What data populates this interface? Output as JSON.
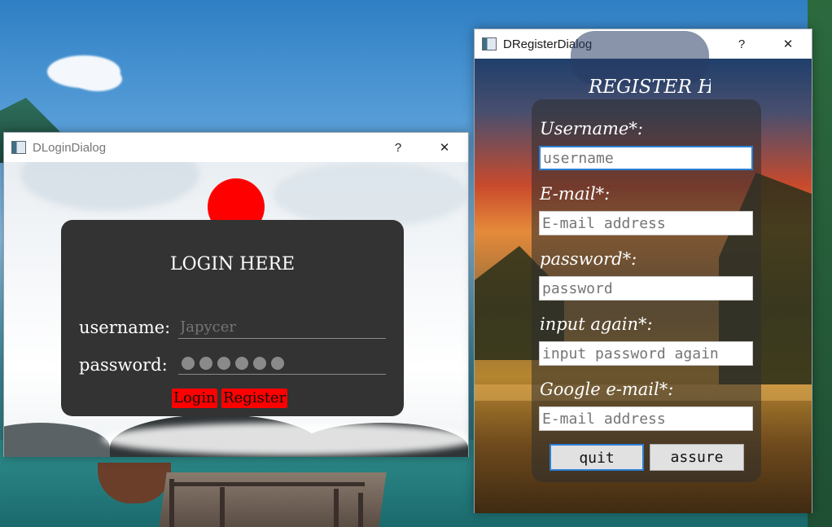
{
  "login_window": {
    "title": "DLoginDialog",
    "help_button": "?",
    "close_button": "✕",
    "heading": "LOGIN HERE",
    "username_label": "username:",
    "username_placeholder": "Japycer",
    "password_label": "password:",
    "password_mask_count": 6,
    "login_button": "Login",
    "register_button": "Register"
  },
  "register_window": {
    "title": "DRegisterDialog",
    "help_button": "?",
    "close_button": "✕",
    "heading": "REGISTER HE",
    "fields": [
      {
        "label": "Username*:",
        "placeholder": "username"
      },
      {
        "label": "E-mail*:",
        "placeholder": "E-mail address"
      },
      {
        "label": "password*:",
        "placeholder": "password"
      },
      {
        "label": "input again*:",
        "placeholder": "input password again"
      },
      {
        "label": "Google e-mail*:",
        "placeholder": "E-mail address"
      }
    ],
    "quit_button": "quit",
    "assure_button": "assure"
  },
  "colors": {
    "accent_red": "#ff0000",
    "panel_dark": "#333333",
    "focus_blue": "#2b7fd4"
  },
  "icons": {
    "window_icon": "app-window-icon",
    "close": "close-icon",
    "help": "help-icon"
  }
}
